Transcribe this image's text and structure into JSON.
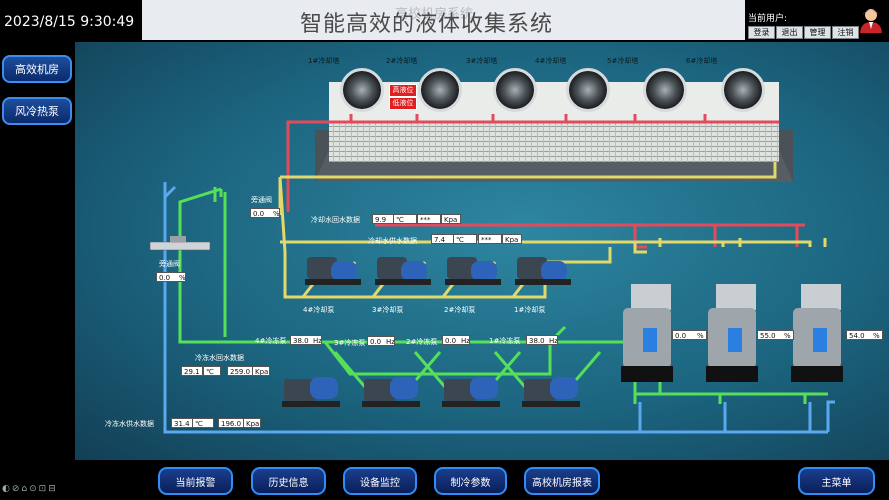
{
  "header": {
    "clock": "2023/8/15 9:30:49",
    "ghost_title": "高校机房系统",
    "title": "智能高效的液体收集系统",
    "user_label": "当前用户:",
    "buttons": [
      "登录",
      "退出",
      "管理",
      "注销"
    ]
  },
  "sidebar": {
    "items": [
      {
        "label": "高效机房"
      },
      {
        "label": "风冷热泵"
      }
    ]
  },
  "towers": {
    "labels": [
      "1#冷却塔",
      "2#冷却塔",
      "3#冷却塔",
      "4#冷却塔",
      "5#冷却塔",
      "6#冷却塔"
    ],
    "alarms": [
      "高液位",
      "低液位"
    ]
  },
  "bypass": {
    "label": "旁通阀",
    "top_value": "0.0",
    "top_unit": "%",
    "left_value": "0.0",
    "left_unit": "%"
  },
  "cooling_water": {
    "return_label": "冷却水回水数据",
    "return_temp": "9.9",
    "return_temp_unit": "℃",
    "return_pressure": "***",
    "return_pressure_unit": "Kpa",
    "supply_label": "冷却水供水数据",
    "supply_temp": "7.4",
    "supply_temp_unit": "℃",
    "supply_pressure": "***",
    "supply_pressure_unit": "Kpa"
  },
  "cooling_pumps": [
    "4#冷却泵",
    "3#冷却泵",
    "2#冷却泵",
    "1#冷却泵"
  ],
  "freezing_pumps": [
    {
      "label": "4#冷冻泵",
      "value": "38.0",
      "unit": "Hz"
    },
    {
      "label": "3#冷冻泵",
      "value": "0.0",
      "unit": "Hz"
    },
    {
      "label": "2#冷冻泵",
      "value": "0.0",
      "unit": "Hz"
    },
    {
      "label": "1#冷冻泵",
      "value": "38.0",
      "unit": "Hz"
    }
  ],
  "chilled_water": {
    "return_label": "冷冻水回水数据",
    "return_temp": "29.1",
    "return_temp_unit": "℃",
    "return_pressure": "259.0",
    "return_pressure_unit": "Kpa",
    "supply_label": "冷冻水供水数据",
    "supply_temp": "31.4",
    "supply_temp_unit": "℃",
    "supply_pressure": "196.0",
    "supply_pressure_unit": "Kpa"
  },
  "chillers": [
    {
      "load": "0.0",
      "unit": "%"
    },
    {
      "load": "55.0",
      "unit": "%"
    },
    {
      "load": "54.0",
      "unit": "%"
    }
  ],
  "footer": {
    "nav": [
      "当前报警",
      "历史信息",
      "设备监控",
      "制冷参数",
      "高校机房报表"
    ],
    "main_menu": "主菜单",
    "tray_icons": "◐⊘⌂⊙⊡⊟"
  },
  "colors": {
    "red_pipe": "#e34b5a",
    "yellow_pipe": "#e3d86a",
    "green_pipe": "#56e05a",
    "blue_pipe": "#5aa9f0",
    "button_border": "#2f8df5"
  }
}
